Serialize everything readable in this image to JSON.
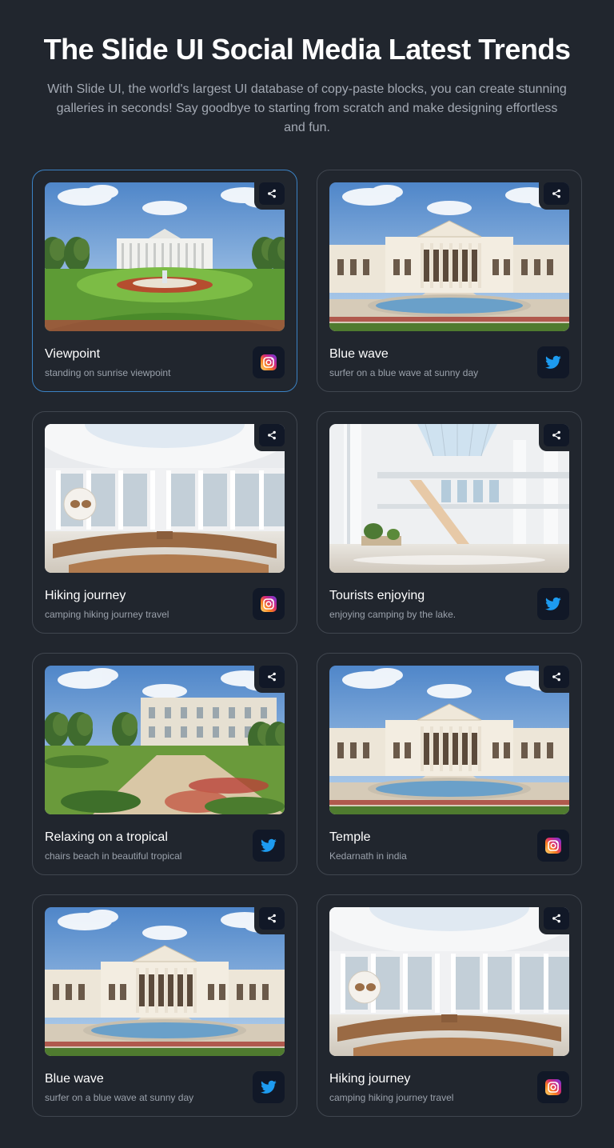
{
  "header": {
    "title": "The Slide UI Social Media Latest Trends",
    "subtitle": "With Slide UI, the world's largest UI database of copy-paste blocks, you can create stunning galleries in seconds! Say goodbye to starting from scratch and make designing effortless and fun."
  },
  "colors": {
    "background": "#21262e",
    "card_border": "#40464f",
    "active_border": "#3b82c4",
    "icon_tile": "#111827",
    "twitter_blue": "#1d9bf0"
  },
  "cards": [
    {
      "title": "Viewpoint",
      "description": "standing on sunrise viewpoint",
      "social": "instagram-icon",
      "scene": "white-house",
      "active": true
    },
    {
      "title": "Blue wave",
      "description": "surfer on a blue wave at sunny day",
      "social": "twitter-icon",
      "scene": "mansion"
    },
    {
      "title": "Hiking journey",
      "description": "camping hiking journey travel",
      "social": "instagram-icon",
      "scene": "rotunda"
    },
    {
      "title": "Tourists enjoying",
      "description": "enjoying camping by the lake.",
      "social": "twitter-icon",
      "scene": "atrium"
    },
    {
      "title": "Relaxing on a tropical",
      "description": "chairs beach in beautiful tropical",
      "social": "twitter-icon",
      "scene": "garden"
    },
    {
      "title": "Temple",
      "description": "Kedarnath in india",
      "social": "instagram-icon",
      "scene": "mansion"
    },
    {
      "title": "Blue wave",
      "description": "surfer on a blue wave at sunny day",
      "social": "twitter-icon",
      "scene": "mansion"
    },
    {
      "title": "Hiking journey",
      "description": "camping hiking journey travel",
      "social": "instagram-icon",
      "scene": "rotunda"
    }
  ]
}
